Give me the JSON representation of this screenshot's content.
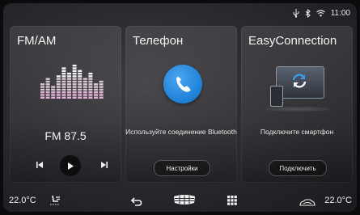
{
  "status": {
    "time": "11:00"
  },
  "cards": {
    "fm": {
      "title": "FM/AM",
      "frequency": "FM 87.5"
    },
    "phone": {
      "title": "Телефон",
      "message": "Используйте соединение Bluetooth",
      "button": "Настройки"
    },
    "easyconnection": {
      "title": "EasyConnection",
      "message": "Подключите смартфон",
      "button": "Подключить"
    }
  },
  "bottom_bar": {
    "temp_left": "22.0°C",
    "temp_right": "22.0°C"
  },
  "colors": {
    "phone_icon_blue": "#1d7fd6",
    "eq_pink": "#d9a3c8",
    "background": "#2a2a2f"
  }
}
